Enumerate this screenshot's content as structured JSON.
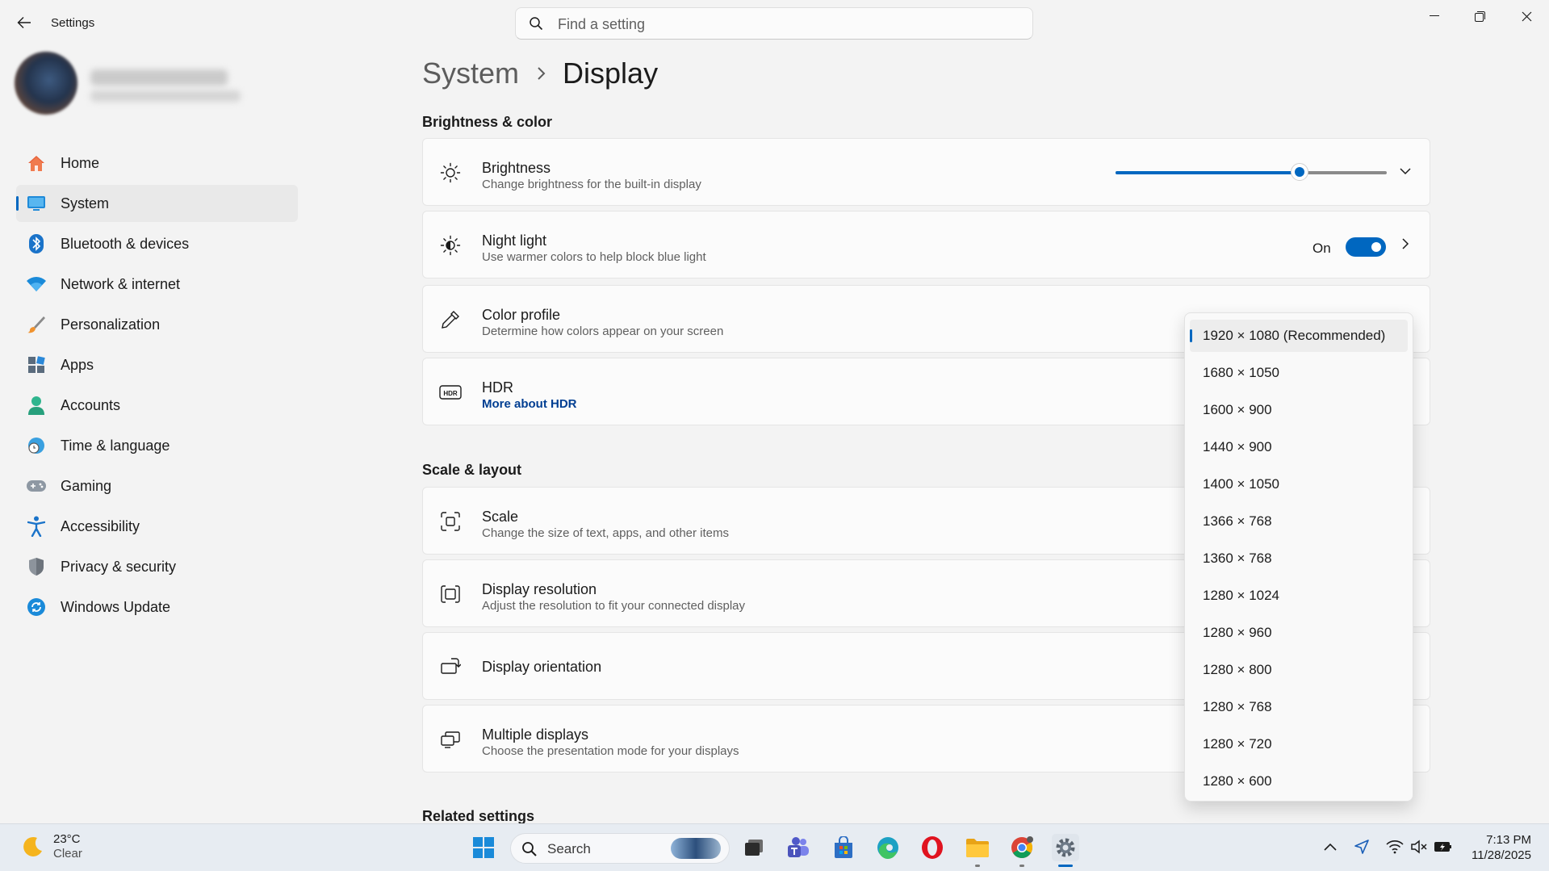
{
  "window": {
    "title": "Settings"
  },
  "search": {
    "placeholder": "Find a setting"
  },
  "sidebar": {
    "items": [
      {
        "label": "Home",
        "icon": "home-icon",
        "active": false
      },
      {
        "label": "System",
        "icon": "monitor-icon",
        "active": true
      },
      {
        "label": "Bluetooth & devices",
        "icon": "bluetooth-icon",
        "active": false
      },
      {
        "label": "Network & internet",
        "icon": "wifi-icon",
        "active": false
      },
      {
        "label": "Personalization",
        "icon": "brush-icon",
        "active": false
      },
      {
        "label": "Apps",
        "icon": "apps-icon",
        "active": false
      },
      {
        "label": "Accounts",
        "icon": "person-icon",
        "active": false
      },
      {
        "label": "Time & language",
        "icon": "globe-clock-icon",
        "active": false
      },
      {
        "label": "Gaming",
        "icon": "gamepad-icon",
        "active": false
      },
      {
        "label": "Accessibility",
        "icon": "accessibility-icon",
        "active": false
      },
      {
        "label": "Privacy & security",
        "icon": "shield-icon",
        "active": false
      },
      {
        "label": "Windows Update",
        "icon": "update-icon",
        "active": false
      }
    ]
  },
  "breadcrumb": {
    "parent": "System",
    "current": "Display"
  },
  "sections": {
    "brightness_color": "Brightness & color",
    "scale_layout": "Scale & layout",
    "related": "Related settings"
  },
  "cards": {
    "brightness": {
      "title": "Brightness",
      "subtitle": "Change brightness for the built-in display",
      "value": 0.68
    },
    "night_light": {
      "title": "Night light",
      "subtitle": "Use warmer colors to help block blue light",
      "state": "On"
    },
    "color_profile": {
      "title": "Color profile",
      "subtitle": "Determine how colors appear on your screen"
    },
    "hdr": {
      "title": "HDR",
      "link": "More about HDR"
    },
    "scale": {
      "title": "Scale",
      "subtitle": "Change the size of text, apps, and other items"
    },
    "resolution": {
      "title": "Display resolution",
      "subtitle": "Adjust the resolution to fit your connected display"
    },
    "orientation": {
      "title": "Display orientation"
    },
    "multiple": {
      "title": "Multiple displays",
      "subtitle": "Choose the presentation mode for your displays"
    }
  },
  "resolution_dropdown": {
    "selected": "1920 × 1080 (Recommended)",
    "options": [
      "1920 × 1080 (Recommended)",
      "1680 × 1050",
      "1600 × 900",
      "1440 × 900",
      "1400 × 1050",
      "1366 × 768",
      "1360 × 768",
      "1280 × 1024",
      "1280 × 960",
      "1280 × 800",
      "1280 × 768",
      "1280 × 720",
      "1280 × 600"
    ]
  },
  "taskbar": {
    "weather": {
      "temp": "23°C",
      "condition": "Clear"
    },
    "search_label": "Search",
    "time": "7:13 PM",
    "date": "11/28/2025"
  },
  "colors": {
    "accent": "#0067c0",
    "background": "#f3f3f3",
    "card": "#fbfbfb"
  }
}
